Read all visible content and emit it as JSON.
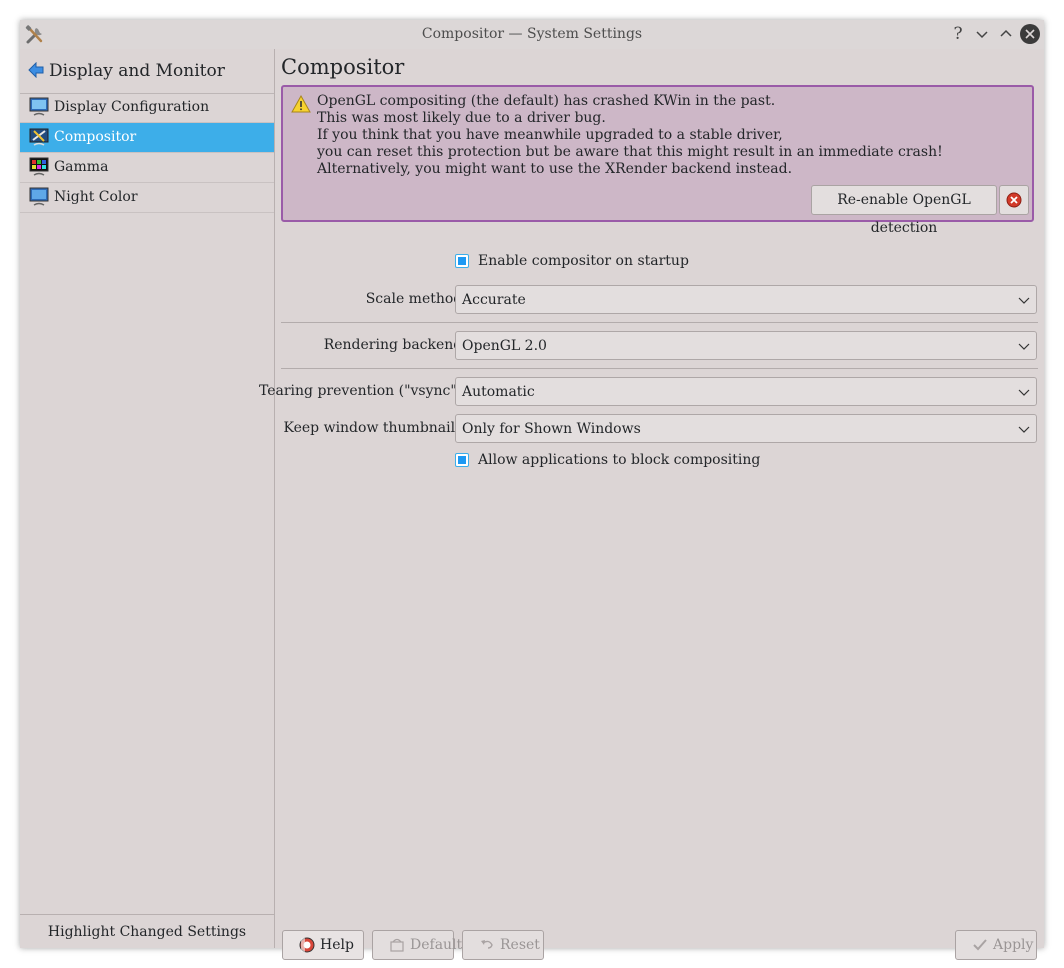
{
  "window": {
    "title": "Compositor — System Settings",
    "buttons": {
      "help": "?",
      "minimize_icon": "chevron-down-icon",
      "maximize_icon": "chevron-up-icon",
      "close_icon": "close-icon"
    }
  },
  "sidebar": {
    "title": "Display and Monitor",
    "items": [
      {
        "label": "Display Configuration",
        "icon": "monitor-icon",
        "active": false
      },
      {
        "label": "Compositor",
        "icon": "compositor-icon",
        "active": true
      },
      {
        "label": "Gamma",
        "icon": "gamma-icon",
        "active": false
      },
      {
        "label": "Night Color",
        "icon": "night-color-icon",
        "active": false
      }
    ],
    "footer": "Highlight Changed Settings"
  },
  "main": {
    "title": "Compositor",
    "alert": {
      "lines": [
        "OpenGL compositing (the default) has crashed KWin in the past.",
        "This was most likely due to a driver bug.",
        "If you think that you have meanwhile upgraded to a stable driver,",
        "you can reset this protection but be aware that this might result in an immediate crash!",
        "Alternatively, you might want to use the XRender backend instead."
      ],
      "action_label": "Re-enable OpenGL detection",
      "colors": {
        "background": "#cdb7c7",
        "border": "#9a5ba8"
      }
    },
    "enable_on_startup": {
      "label": "Enable compositor on startup",
      "checked": true
    },
    "scale_method": {
      "label": "Scale method:",
      "value": "Accurate"
    },
    "rendering_backend": {
      "label": "Rendering backend:",
      "value": "OpenGL 2.0"
    },
    "tearing_prevention": {
      "label": "Tearing prevention (\"vsync\"):",
      "value": "Automatic"
    },
    "window_thumbnails": {
      "label": "Keep window thumbnails:",
      "value": "Only for Shown Windows"
    },
    "allow_block": {
      "label": "Allow applications to block compositing",
      "checked": true
    }
  },
  "footer_buttons": {
    "help": "Help",
    "defaults": "Defaults",
    "reset": "Reset",
    "apply": "Apply"
  },
  "colors": {
    "accent": "#3daee9",
    "window_bg": "#dcd5d5"
  }
}
